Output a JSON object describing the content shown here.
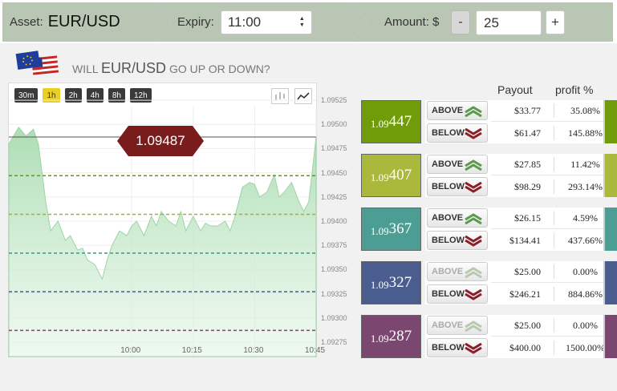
{
  "header": {
    "asset_label": "Asset:",
    "asset_value": "EUR/USD",
    "expiry_label": "Expiry:",
    "expiry_value": "11:00",
    "amount_label": "Amount: $",
    "minus": "-",
    "amount_value": "25",
    "plus": "+"
  },
  "question": {
    "prefix": "WILL",
    "asset": "EUR/USD",
    "suffix": "GO UP OR DOWN?"
  },
  "timeframes": [
    "30m",
    "1h",
    "2h",
    "4h",
    "8h",
    "12h"
  ],
  "active_timeframe": "1h",
  "chart_data": {
    "type": "area",
    "current_price": "1.09487",
    "y_ticks": [
      "1.09525",
      "1.09500",
      "1.09475",
      "1.09450",
      "1.09425",
      "1.09400",
      "1.09375",
      "1.09350",
      "1.09325",
      "1.09300",
      "1.09275"
    ],
    "y_range": [
      1.0926,
      1.09535
    ],
    "x_ticks": [
      "10:00",
      "10:15",
      "10:30",
      "10:45"
    ],
    "x_range": [
      -0.5,
      0.75
    ],
    "series": [
      {
        "x": [
          -0.5,
          -0.46,
          -0.43,
          -0.4,
          -0.38,
          -0.35,
          -0.33,
          -0.3,
          -0.27,
          -0.25,
          -0.22,
          -0.2,
          -0.18,
          -0.15,
          -0.12,
          -0.1,
          -0.08,
          -0.05,
          -0.02,
          0.0,
          0.02,
          0.05,
          0.08,
          0.1,
          0.12,
          0.15,
          0.18,
          0.2,
          0.22,
          0.25,
          0.28,
          0.3,
          0.32,
          0.35,
          0.38,
          0.4,
          0.42,
          0.45,
          0.48,
          0.5,
          0.52,
          0.55,
          0.58,
          0.6,
          0.62,
          0.65,
          0.68,
          0.7,
          0.72,
          0.75
        ],
        "y": [
          1.0948,
          1.09497,
          1.09488,
          1.09495,
          1.0948,
          1.0942,
          1.0939,
          1.094,
          1.0938,
          1.09385,
          1.0937,
          1.09372,
          1.0936,
          1.09355,
          1.0934,
          1.0936,
          1.09375,
          1.0939,
          1.09385,
          1.09395,
          1.094,
          1.09385,
          1.09405,
          1.09395,
          1.0941,
          1.094,
          1.09395,
          1.0941,
          1.0939,
          1.09405,
          1.0939,
          1.09398,
          1.09395,
          1.09395,
          1.094,
          1.0939,
          1.09405,
          1.09435,
          1.0944,
          1.09438,
          1.09425,
          1.0943,
          1.09448,
          1.09425,
          1.0943,
          1.0944,
          1.0942,
          1.0941,
          1.0942,
          1.09487
        ]
      }
    ],
    "levels": [
      {
        "value": 1.09447,
        "color": "#6a9a00"
      },
      {
        "value": 1.09407,
        "color": "#a8b030"
      },
      {
        "value": 1.09367,
        "color": "#3a9a8a"
      },
      {
        "value": 1.09327,
        "color": "#4a5a8a"
      },
      {
        "value": 1.09287,
        "color": "#7a4a6a"
      }
    ]
  },
  "table": {
    "payout_header": "Payout",
    "profit_header": "profit %",
    "cards": [
      {
        "strike_small": "1.09",
        "strike_big": "447",
        "color": "#6f9c08",
        "above": {
          "label": "ABOVE",
          "payout": "$33.77",
          "profit": "35.08%",
          "disabled": false
        },
        "below": {
          "label": "BELOW",
          "payout": "$61.47",
          "profit": "145.88%"
        }
      },
      {
        "strike_small": "1.09",
        "strike_big": "407",
        "color": "#aab83c",
        "above": {
          "label": "ABOVE",
          "payout": "$27.85",
          "profit": "11.42%",
          "disabled": false
        },
        "below": {
          "label": "BELOW",
          "payout": "$98.29",
          "profit": "293.14%"
        }
      },
      {
        "strike_small": "1.09",
        "strike_big": "367",
        "color": "#4c9d94",
        "above": {
          "label": "ABOVE",
          "payout": "$26.15",
          "profit": "4.59%",
          "disabled": false
        },
        "below": {
          "label": "BELOW",
          "payout": "$134.41",
          "profit": "437.66%"
        }
      },
      {
        "strike_small": "1.09",
        "strike_big": "327",
        "color": "#4b5c8e",
        "above": {
          "label": "ABOVE",
          "payout": "$25.00",
          "profit": "0.00%",
          "disabled": true
        },
        "below": {
          "label": "BELOW",
          "payout": "$246.21",
          "profit": "884.86%"
        }
      },
      {
        "strike_small": "1.09",
        "strike_big": "287",
        "color": "#7b4670",
        "above": {
          "label": "ABOVE",
          "payout": "$25.00",
          "profit": "0.00%",
          "disabled": true
        },
        "below": {
          "label": "BELOW",
          "payout": "$400.00",
          "profit": "1500.00%"
        }
      }
    ]
  },
  "icons": {
    "flag": "eu-us-flag-icon",
    "candles": "candlestick-chart-icon",
    "line": "line-chart-icon",
    "up": "chevron-up-icon",
    "down": "chevron-down-icon"
  }
}
